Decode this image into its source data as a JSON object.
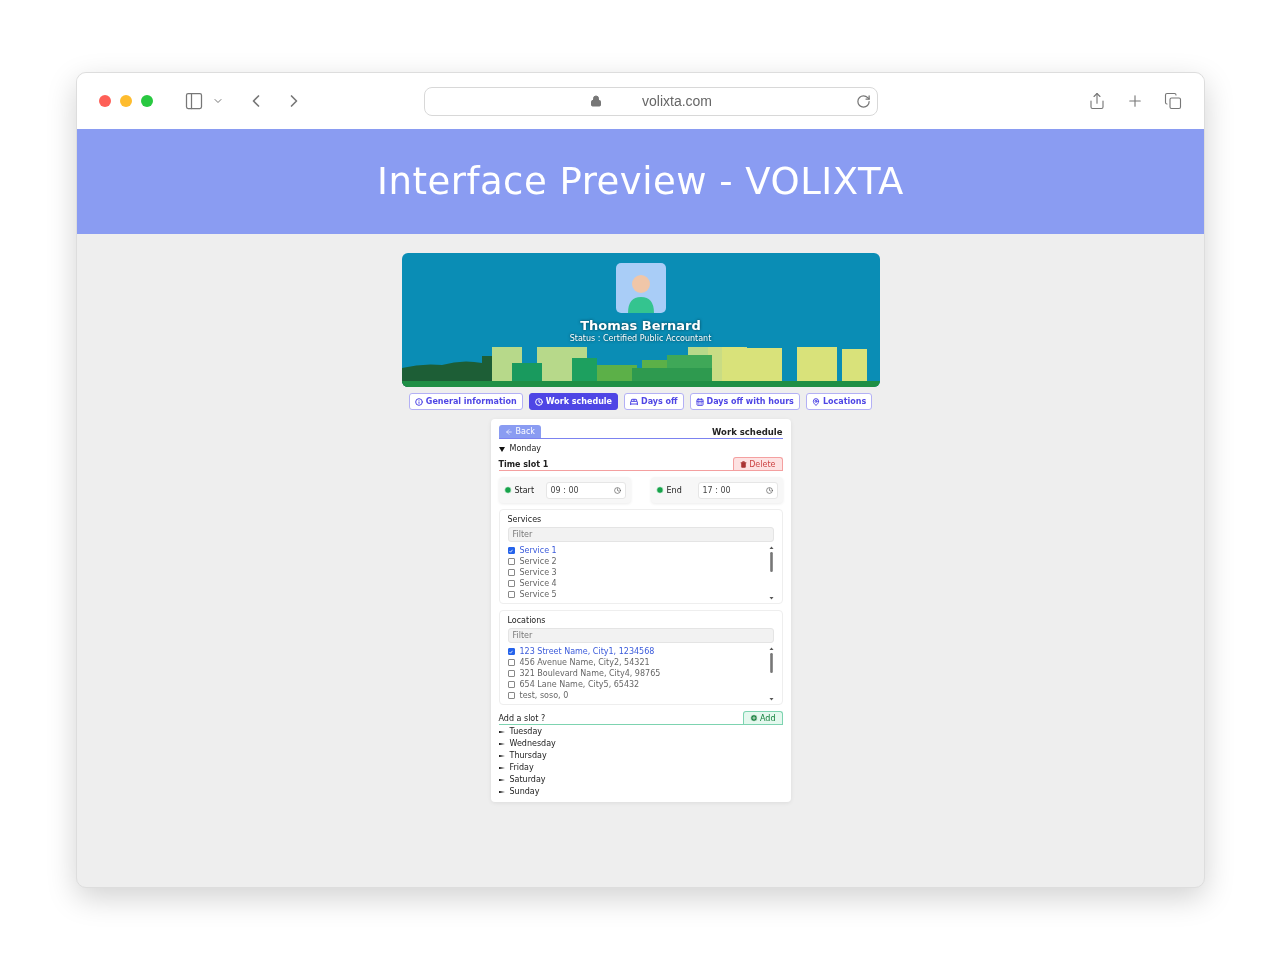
{
  "browser": {
    "url": "volixta.com"
  },
  "header": {
    "title": "Interface Preview - VOLIXTA"
  },
  "profile": {
    "name": "Thomas Bernard",
    "status": "Status : Certified Public Accountant"
  },
  "tabs": [
    {
      "label": "General information",
      "selected": false
    },
    {
      "label": "Work schedule",
      "selected": true
    },
    {
      "label": "Days off",
      "selected": false
    },
    {
      "label": "Days off with hours",
      "selected": false
    },
    {
      "label": "Locations",
      "selected": false
    }
  ],
  "schedule": {
    "back": "Back",
    "title": "Work schedule",
    "days": [
      {
        "label": "Monday",
        "expanded": true,
        "slots": [
          {
            "title": "Time slot 1",
            "delete": "Delete",
            "start_label": "Start",
            "start": "09 : 00",
            "end_label": "End",
            "end": "17 : 00",
            "services": {
              "title": "Services",
              "placeholder": "Filter",
              "items": [
                {
                  "label": "Service 1",
                  "checked": true
                },
                {
                  "label": "Service 2",
                  "checked": false
                },
                {
                  "label": "Service 3",
                  "checked": false
                },
                {
                  "label": "Service 4",
                  "checked": false
                },
                {
                  "label": "Service 5",
                  "checked": false
                }
              ]
            },
            "locations": {
              "title": "Locations",
              "placeholder": "Filter",
              "items": [
                {
                  "label": "123 Street Name, City1, 1234568",
                  "checked": true
                },
                {
                  "label": "456 Avenue Name, City2, 54321",
                  "checked": false
                },
                {
                  "label": "321 Boulevard Name, City4, 98765",
                  "checked": false
                },
                {
                  "label": "654 Lane Name, City5, 65432",
                  "checked": false
                },
                {
                  "label": "test, soso, 0",
                  "checked": false
                }
              ]
            }
          }
        ],
        "add_prompt": "Add a slot ?",
        "add": "Add"
      },
      {
        "label": "Tuesday",
        "expanded": false
      },
      {
        "label": "Wednesday",
        "expanded": false
      },
      {
        "label": "Thursday",
        "expanded": false
      },
      {
        "label": "Friday",
        "expanded": false
      },
      {
        "label": "Saturday",
        "expanded": false
      },
      {
        "label": "Sunday",
        "expanded": false
      }
    ]
  }
}
